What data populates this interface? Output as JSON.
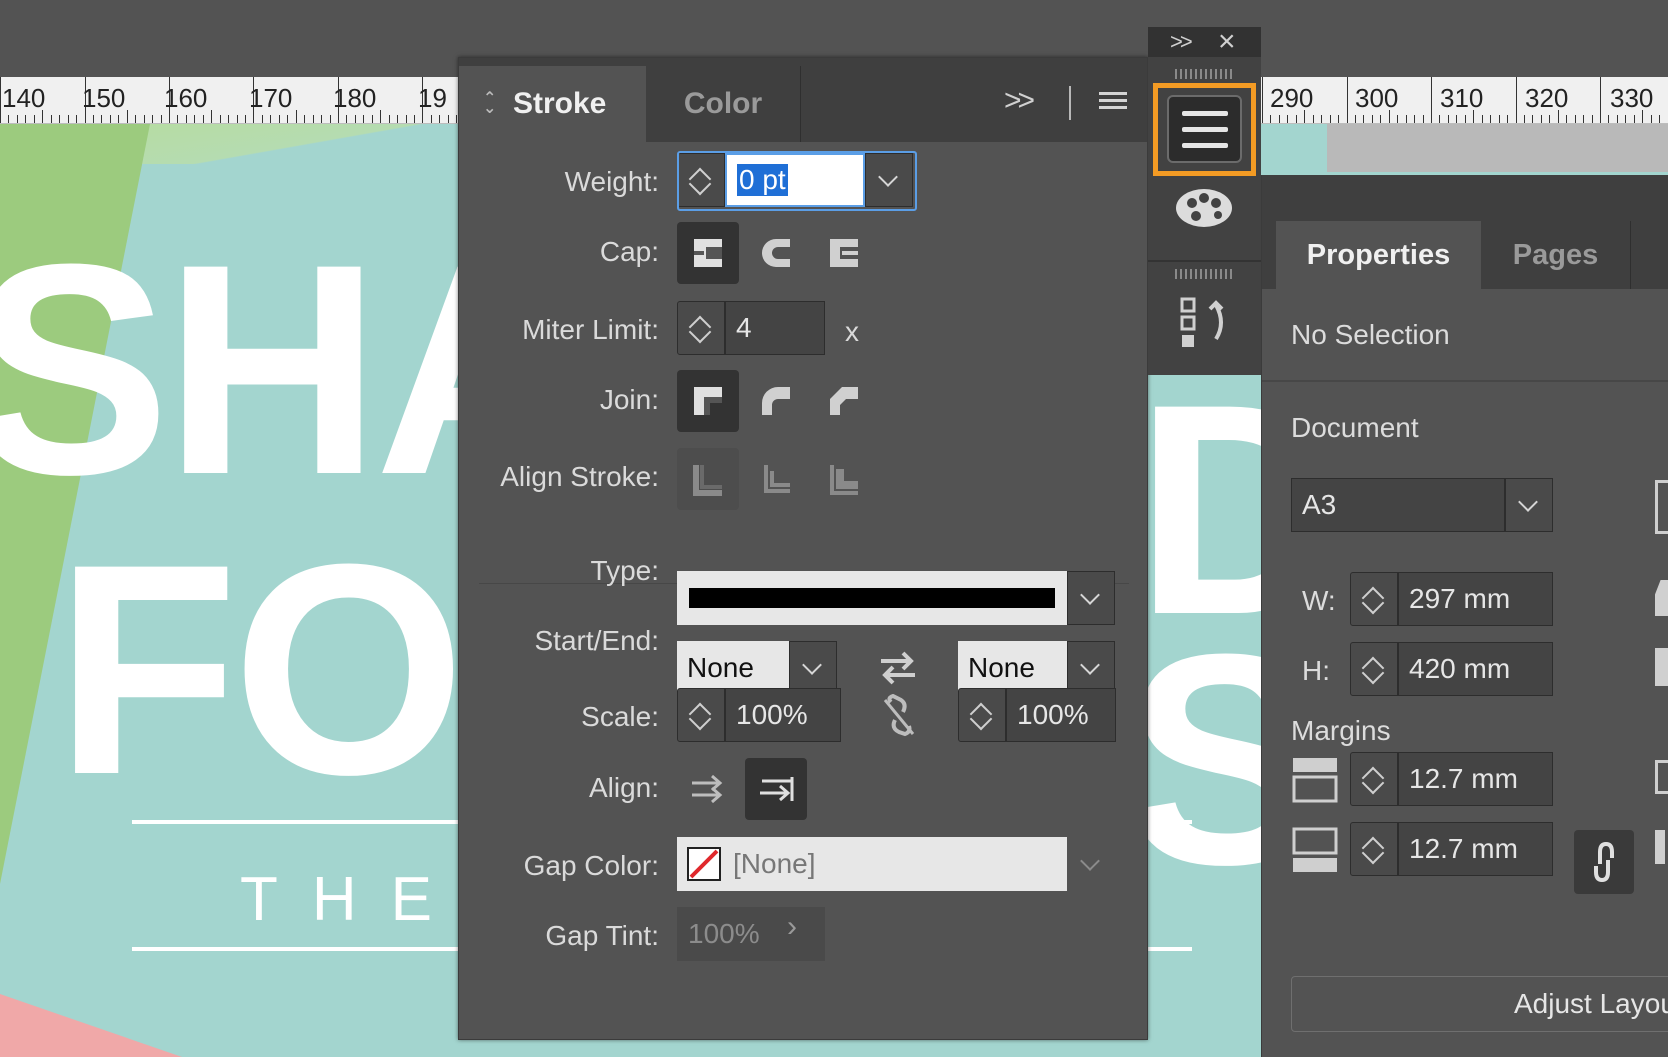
{
  "ruler": {
    "labels": [
      "140",
      "150",
      "160",
      "170",
      "180",
      "19",
      "290",
      "300",
      "310",
      "320",
      "330"
    ]
  },
  "artwork": {
    "line1": "SHA",
    "line2": "FO",
    "right1": "D",
    "right2": "S",
    "tagline": "THE S"
  },
  "stroke_panel": {
    "tabs": {
      "stroke": "Stroke",
      "color": "Color"
    },
    "weight": {
      "label": "Weight:",
      "value": "0 pt"
    },
    "cap": {
      "label": "Cap:"
    },
    "miter": {
      "label": "Miter Limit:",
      "value": "4",
      "unit": "x"
    },
    "join": {
      "label": "Join:"
    },
    "align_stroke": {
      "label": "Align Stroke:"
    },
    "type": {
      "label": "Type:"
    },
    "start_end": {
      "label": "Start/End:",
      "start": "None",
      "end": "None"
    },
    "scale": {
      "label": "Scale:",
      "start": "100%",
      "end": "100%"
    },
    "align": {
      "label": "Align:"
    },
    "gap_color": {
      "label": "Gap Color:",
      "value": "[None]"
    },
    "gap_tint": {
      "label": "Gap Tint:",
      "value": "100%"
    }
  },
  "properties_panel": {
    "tabs": {
      "properties": "Properties",
      "pages": "Pages"
    },
    "selection": "No Selection",
    "document_heading": "Document",
    "page_size": "A3",
    "width": {
      "label": "W:",
      "value": "297 mm"
    },
    "height": {
      "label": "H:",
      "value": "420 mm"
    },
    "margins_heading": "Margins",
    "margin_top": "12.7 mm",
    "margin_bottom": "12.7 mm",
    "adjust_button": "Adjust Layout"
  },
  "colors": {
    "accent_highlight": "#f39b24",
    "selection_blue": "#1f6fd6",
    "panel_bg": "#535353",
    "canvas_teal": "#a3d5cf"
  }
}
